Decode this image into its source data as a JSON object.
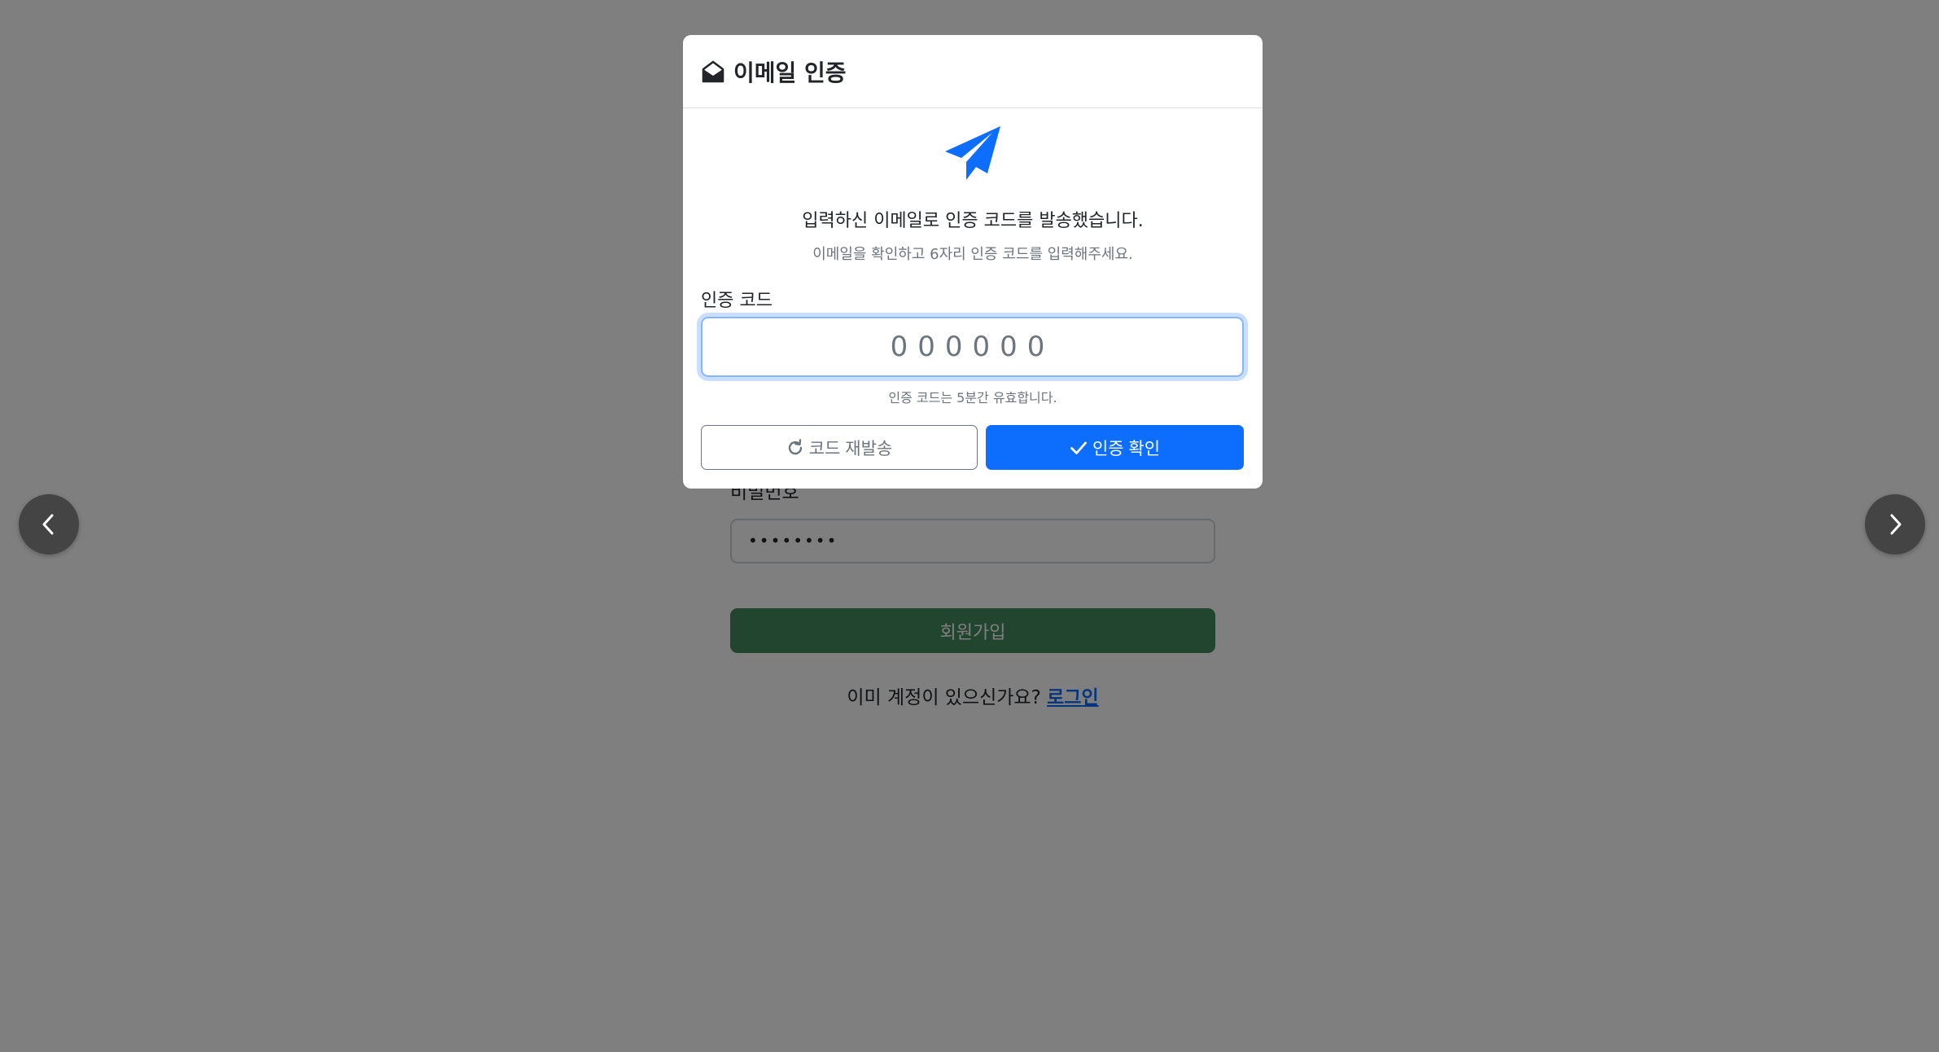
{
  "signup": {
    "password_label": "비밀번호",
    "password_value": "••••••••",
    "submit_label": "회원가입",
    "login_prompt": "이미 계정이 있으신가요?",
    "login_link": "로그인"
  },
  "modal": {
    "title": "이메일 인증",
    "title_icon": "envelope-open-icon",
    "hero_icon": "paper-plane-icon",
    "message_main": "입력하신 이메일로 인증 코드를 발송했습니다.",
    "message_sub": "이메일을 확인하고 6자리 인증 코드를 입력해주세요.",
    "code_label": "인증 코드",
    "code_placeholder": "000000",
    "code_value": "",
    "code_hint": "인증 코드는 5분간 유효합니다.",
    "resend_label": "코드 재발송",
    "confirm_label": "인증 확인"
  },
  "colors": {
    "primary": "#0d6efd",
    "signup_button": "#438a5e",
    "backdrop": "rgba(0,0,0,0.5)"
  },
  "nav": {
    "prev_icon": "chevron-left-icon",
    "next_icon": "chevron-right-icon"
  }
}
